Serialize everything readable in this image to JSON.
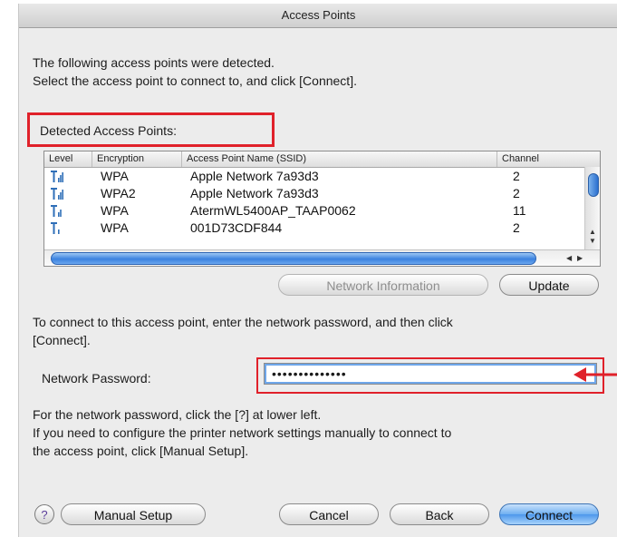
{
  "window": {
    "title": "Access Points"
  },
  "intro": {
    "line1": "The following access points were detected.",
    "line2": "Select the access point to connect to, and click [Connect]."
  },
  "detected_label": "Detected Access Points:",
  "table": {
    "columns": [
      "Level",
      "Encryption",
      "Access Point Name (SSID)",
      "Channel"
    ],
    "rows": [
      {
        "level_icon": "signal-strong-icon",
        "encryption": "WPA",
        "ssid": "Apple Network 7a93d3",
        "channel": "2"
      },
      {
        "level_icon": "signal-strong-icon",
        "encryption": "WPA2",
        "ssid": "Apple Network 7a93d3",
        "channel": "2"
      },
      {
        "level_icon": "signal-medium-icon",
        "encryption": "WPA",
        "ssid": "AtermWL5400AP_TAAP0062",
        "channel": "11"
      },
      {
        "level_icon": "signal-weak-icon",
        "encryption": "WPA",
        "ssid": "001D73CDF844",
        "channel": "2"
      }
    ],
    "selected_row": 0
  },
  "buttons": {
    "network_information": "Network Information",
    "update": "Update",
    "help": "?",
    "manual_setup": "Manual Setup",
    "cancel": "Cancel",
    "back": "Back",
    "connect": "Connect"
  },
  "password_prompt": {
    "line1": "To connect to this access point, enter the network password, and then click",
    "line2": "[Connect]."
  },
  "password": {
    "label": "Network Password:",
    "value": "••••••••••••••"
  },
  "help_text": {
    "line1": "For the network password, click the [?] at lower left.",
    "line2": "If you need to configure the printer network settings manually to connect to",
    "line3": "the access point, click [Manual Setup]."
  },
  "colors": {
    "highlight": "#e0212a",
    "accent": "#4d97eb"
  }
}
